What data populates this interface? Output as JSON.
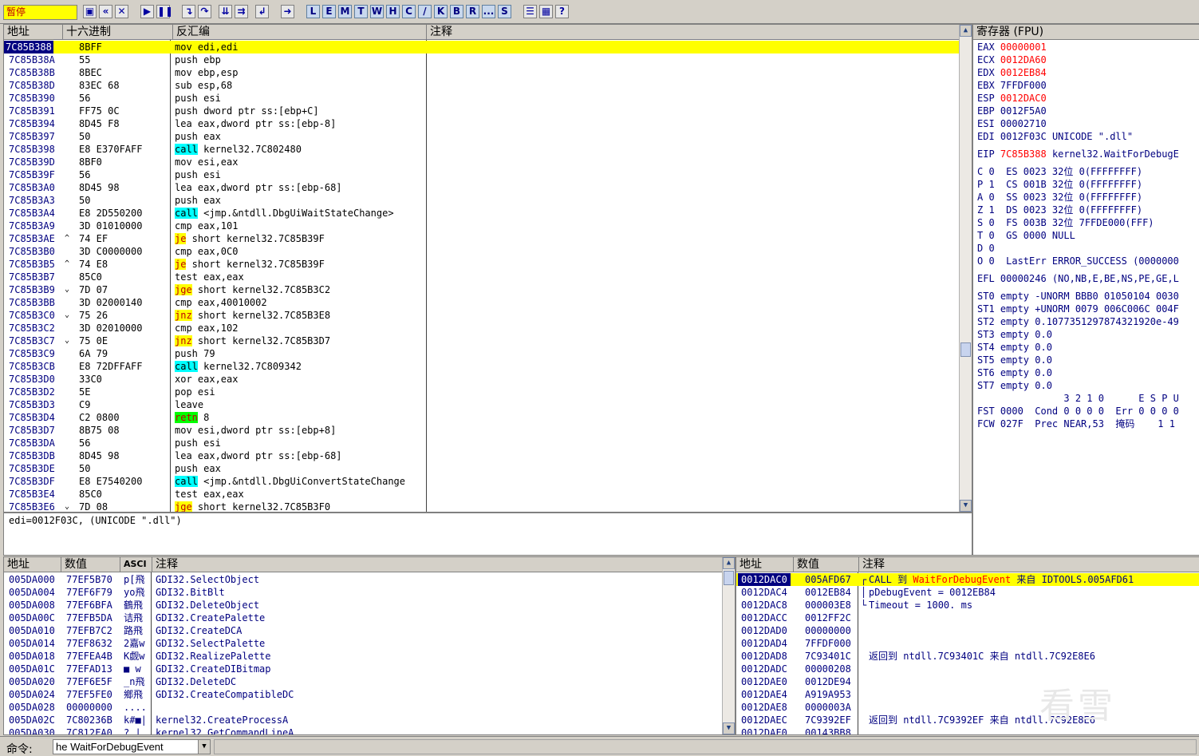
{
  "toolbar": {
    "status": "暂停",
    "letter_buttons": [
      "L",
      "E",
      "M",
      "T",
      "W",
      "H",
      "C",
      "/",
      "K",
      "B",
      "R",
      "...",
      "S"
    ]
  },
  "disasm": {
    "headers": {
      "address": "地址",
      "hex": "十六进制",
      "disasm": "反汇编",
      "comment": "注释"
    },
    "rows": [
      {
        "addr": "7C85B388",
        "mark": "",
        "hex": "8BFF",
        "pre": "",
        "kw": "",
        "asm": "mov edi,edi",
        "style": ""
      },
      {
        "addr": "7C85B38A",
        "mark": "",
        "hex": "55",
        "pre": "",
        "kw": "",
        "asm": "push ebp",
        "style": ""
      },
      {
        "addr": "7C85B38B",
        "mark": "",
        "hex": "8BEC",
        "pre": "",
        "kw": "",
        "asm": "mov ebp,esp",
        "style": ""
      },
      {
        "addr": "7C85B38D",
        "mark": "",
        "hex": "83EC 68",
        "pre": "",
        "kw": "",
        "asm": "sub esp,68",
        "style": ""
      },
      {
        "addr": "7C85B390",
        "mark": "",
        "hex": "56",
        "pre": "",
        "kw": "",
        "asm": "push esi",
        "style": ""
      },
      {
        "addr": "7C85B391",
        "mark": "",
        "hex": "FF75 0C",
        "pre": "",
        "kw": "",
        "asm": "push dword ptr ss:[ebp+C]",
        "style": ""
      },
      {
        "addr": "7C85B394",
        "mark": "",
        "hex": "8D45 F8",
        "pre": "",
        "kw": "",
        "asm": "lea eax,dword ptr ss:[ebp-8]",
        "style": ""
      },
      {
        "addr": "7C85B397",
        "mark": "",
        "hex": "50",
        "pre": "",
        "kw": "",
        "asm": "push eax",
        "style": ""
      },
      {
        "addr": "7C85B398",
        "mark": "",
        "hex": "E8 E370FAFF",
        "pre": "",
        "kw": "call",
        "asm": " kernel32.7C802480",
        "style": "hl"
      },
      {
        "addr": "7C85B39D",
        "mark": "",
        "hex": "8BF0",
        "pre": "",
        "kw": "",
        "asm": "mov esi,eax",
        "style": ""
      },
      {
        "addr": "7C85B39F",
        "mark": "",
        "hex": "56",
        "pre": "",
        "kw": "",
        "asm": "push esi",
        "style": ""
      },
      {
        "addr": "7C85B3A0",
        "mark": "",
        "hex": "8D45 98",
        "pre": "",
        "kw": "",
        "asm": "lea eax,dword ptr ss:[ebp-68]",
        "style": ""
      },
      {
        "addr": "7C85B3A3",
        "mark": "",
        "hex": "50",
        "pre": "",
        "kw": "",
        "asm": "push eax",
        "style": ""
      },
      {
        "addr": "7C85B3A4",
        "mark": "",
        "hex": "E8 2D550200",
        "pre": "",
        "kw": "call",
        "asm": " <jmp.&ntdll.DbgUiWaitStateChange>",
        "style": "hl"
      },
      {
        "addr": "7C85B3A9",
        "mark": "",
        "hex": "3D 01010000",
        "pre": "",
        "kw": "",
        "asm": "cmp eax,101",
        "style": ""
      },
      {
        "addr": "7C85B3AE",
        "mark": "^",
        "hex": "74 EF",
        "pre": "",
        "kw": "je",
        "asm": " short kernel32.7C85B39F",
        "style": "hly"
      },
      {
        "addr": "7C85B3B0",
        "mark": "",
        "hex": "3D C0000000",
        "pre": "",
        "kw": "",
        "asm": "cmp eax,0C0",
        "style": ""
      },
      {
        "addr": "7C85B3B5",
        "mark": "^",
        "hex": "74 E8",
        "pre": "",
        "kw": "je",
        "asm": " short kernel32.7C85B39F",
        "style": "hly"
      },
      {
        "addr": "7C85B3B7",
        "mark": "",
        "hex": "85C0",
        "pre": "",
        "kw": "",
        "asm": "test eax,eax",
        "style": ""
      },
      {
        "addr": "7C85B3B9",
        "mark": "⌄",
        "hex": "7D 07",
        "pre": "",
        "kw": "jge",
        "asm": " short kernel32.7C85B3C2",
        "style": "hly"
      },
      {
        "addr": "7C85B3BB",
        "mark": "",
        "hex": "3D 02000140",
        "pre": "",
        "kw": "",
        "asm": "cmp eax,40010002",
        "style": ""
      },
      {
        "addr": "7C85B3C0",
        "mark": "⌄",
        "hex": "75 26",
        "pre": "",
        "kw": "jnz",
        "asm": " short kernel32.7C85B3E8",
        "style": "hly"
      },
      {
        "addr": "7C85B3C2",
        "mark": "",
        "hex": "3D 02010000",
        "pre": "",
        "kw": "",
        "asm": "cmp eax,102",
        "style": ""
      },
      {
        "addr": "7C85B3C7",
        "mark": "⌄",
        "hex": "75 0E",
        "pre": "",
        "kw": "jnz",
        "asm": " short kernel32.7C85B3D7",
        "style": "hly"
      },
      {
        "addr": "7C85B3C9",
        "mark": "",
        "hex": "6A 79",
        "pre": "",
        "kw": "",
        "asm": "push 79",
        "style": ""
      },
      {
        "addr": "7C85B3CB",
        "mark": "",
        "hex": "E8 72DFFAFF",
        "pre": "",
        "kw": "call",
        "asm": " kernel32.7C809342",
        "style": "hl"
      },
      {
        "addr": "7C85B3D0",
        "mark": "",
        "hex": "33C0",
        "pre": "",
        "kw": "",
        "asm": "xor eax,eax",
        "style": ""
      },
      {
        "addr": "7C85B3D2",
        "mark": "",
        "hex": "5E",
        "pre": "",
        "kw": "",
        "asm": "pop esi",
        "style": ""
      },
      {
        "addr": "7C85B3D3",
        "mark": "",
        "hex": "C9",
        "pre": "",
        "kw": "",
        "asm": "leave",
        "style": ""
      },
      {
        "addr": "7C85B3D4",
        "mark": "",
        "hex": "C2 0800",
        "pre": "",
        "kw": "retn",
        "asm": " 8",
        "style": "hlg"
      },
      {
        "addr": "7C85B3D7",
        "mark": "",
        "hex": "8B75 08",
        "pre": "",
        "kw": "",
        "asm": "mov esi,dword ptr ss:[ebp+8]",
        "style": ""
      },
      {
        "addr": "7C85B3DA",
        "mark": "",
        "hex": "56",
        "pre": "",
        "kw": "",
        "asm": "push esi",
        "style": ""
      },
      {
        "addr": "7C85B3DB",
        "mark": "",
        "hex": "8D45 98",
        "pre": "",
        "kw": "",
        "asm": "lea eax,dword ptr ss:[ebp-68]",
        "style": ""
      },
      {
        "addr": "7C85B3DE",
        "mark": "",
        "hex": "50",
        "pre": "",
        "kw": "",
        "asm": "push eax",
        "style": ""
      },
      {
        "addr": "7C85B3DF",
        "mark": "",
        "hex": "E8 E7540200",
        "pre": "",
        "kw": "call",
        "asm": " <jmp.&ntdll.DbgUiConvertStateChange",
        "style": "hl"
      },
      {
        "addr": "7C85B3E4",
        "mark": "",
        "hex": "85C0",
        "pre": "",
        "kw": "",
        "asm": "test eax,eax",
        "style": ""
      },
      {
        "addr": "7C85B3E6",
        "mark": "⌄",
        "hex": "7D 08",
        "pre": "",
        "kw": "jge",
        "asm": " short kernel32.7C85B3F0",
        "style": "hly"
      }
    ],
    "info_line": "edi=0012F03C, (UNICODE \".dll\")"
  },
  "registers": {
    "title": "寄存器 (FPU)",
    "gpr": [
      {
        "name": "EAX",
        "value": "00000001",
        "changed": true,
        "extra": ""
      },
      {
        "name": "ECX",
        "value": "0012DA60",
        "changed": true,
        "extra": ""
      },
      {
        "name": "EDX",
        "value": "0012EB84",
        "changed": true,
        "extra": ""
      },
      {
        "name": "EBX",
        "value": "7FFDF000",
        "changed": false,
        "extra": ""
      },
      {
        "name": "ESP",
        "value": "0012DAC0",
        "changed": true,
        "extra": ""
      },
      {
        "name": "EBP",
        "value": "0012F5A0",
        "changed": false,
        "extra": ""
      },
      {
        "name": "ESI",
        "value": "00002710",
        "changed": false,
        "extra": ""
      },
      {
        "name": "EDI",
        "value": "0012F03C",
        "changed": false,
        "extra": " UNICODE \".dll\""
      }
    ],
    "eip": {
      "name": "EIP",
      "value": "7C85B388",
      "extra": " kernel32.WaitForDebugE"
    },
    "flags": [
      "C 0  ES 0023 32位 0(FFFFFFFF)",
      "P 1  CS 001B 32位 0(FFFFFFFF)",
      "A 0  SS 0023 32位 0(FFFFFFFF)",
      "Z 1  DS 0023 32位 0(FFFFFFFF)",
      "S 0  FS 003B 32位 7FFDE000(FFF)",
      "T 0  GS 0000 NULL",
      "D 0",
      "O 0  LastErr ERROR_SUCCESS (0000000"
    ],
    "efl": "EFL 00000246 (NO,NB,E,BE,NS,PE,GE,L",
    "fpu": [
      "ST0 empty -UNORM BBB0 01050104 0030",
      "ST1 empty +UNORM 0079 006C006C 004F",
      "ST2 empty 0.1077351297874321920e-49",
      "ST3 empty 0.0",
      "ST4 empty 0.0",
      "ST5 empty 0.0",
      "ST6 empty 0.0",
      "ST7 empty 0.0"
    ],
    "fpu_status": [
      "               3 2 1 0      E S P U",
      "FST 0000  Cond 0 0 0 0  Err 0 0 0 0",
      "FCW 027F  Prec NEAR,53  掩码    1 1"
    ]
  },
  "dump": {
    "headers": {
      "address": "地址",
      "value": "数值",
      "ascii": "ASCI",
      "comment": "注释"
    },
    "rows": [
      {
        "addr": "005DA000",
        "val": "77EF5B70",
        "asc": "p[飛",
        "cmt": "GDI32.SelectObject"
      },
      {
        "addr": "005DA004",
        "val": "77EF6F79",
        "asc": "yo飛",
        "cmt": "GDI32.BitBlt"
      },
      {
        "addr": "005DA008",
        "val": "77EF6BFA",
        "asc": "鶴飛",
        "cmt": "GDI32.DeleteObject"
      },
      {
        "addr": "005DA00C",
        "val": "77EFB5DA",
        "asc": "诘飛",
        "cmt": "GDI32.CreatePalette"
      },
      {
        "addr": "005DA010",
        "val": "77EFB7C2",
        "asc": "路飛",
        "cmt": "GDI32.CreateDCA"
      },
      {
        "addr": "005DA014",
        "val": "77EF8632",
        "asc": "2嘉w",
        "cmt": "GDI32.SelectPalette"
      },
      {
        "addr": "005DA018",
        "val": "77EFEA4B",
        "asc": "K觑w",
        "cmt": "GDI32.RealizePalette"
      },
      {
        "addr": "005DA01C",
        "val": "77EFAD13",
        "asc": "■ w",
        "cmt": "GDI32.CreateDIBitmap"
      },
      {
        "addr": "005DA020",
        "val": "77EF6E5F",
        "asc": "_n飛",
        "cmt": "GDI32.DeleteDC"
      },
      {
        "addr": "005DA024",
        "val": "77EF5FE0",
        "asc": "鄉飛",
        "cmt": "GDI32.CreateCompatibleDC"
      },
      {
        "addr": "005DA028",
        "val": "00000000",
        "asc": "....",
        "cmt": ""
      },
      {
        "addr": "005DA02C",
        "val": "7C80236B",
        "asc": "k#■|",
        "cmt": "kernel32.CreateProcessA"
      },
      {
        "addr": "005DA030",
        "val": "7C812FA0",
        "asc": "?.|",
        "cmt": "kernel32.GetCommandLineA"
      }
    ]
  },
  "stack": {
    "headers": {
      "address": "地址",
      "value": "数值",
      "comment": "注释"
    },
    "rows": [
      {
        "addr": "0012DAC0",
        "val": "005AFD67",
        "br": "┌",
        "cmt": "CALL 到 ",
        "fn": "WaitForDebugEvent",
        "cmt2": " 来自 IDTOOLS.005AFD61",
        "sel": true
      },
      {
        "addr": "0012DAC4",
        "val": "0012EB84",
        "br": "│",
        "cmt": "pDebugEvent = 0012EB84",
        "fn": "",
        "cmt2": "",
        "sel": false
      },
      {
        "addr": "0012DAC8",
        "val": "000003E8",
        "br": "└",
        "cmt": "Timeout = 1000. ms",
        "fn": "",
        "cmt2": "",
        "sel": false
      },
      {
        "addr": "0012DACC",
        "val": "0012FF2C",
        "br": "",
        "cmt": "",
        "fn": "",
        "cmt2": "",
        "sel": false
      },
      {
        "addr": "0012DAD0",
        "val": "00000000",
        "br": "",
        "cmt": "",
        "fn": "",
        "cmt2": "",
        "sel": false
      },
      {
        "addr": "0012DAD4",
        "val": "7FFDF000",
        "br": "",
        "cmt": "",
        "fn": "",
        "cmt2": "",
        "sel": false
      },
      {
        "addr": "0012DAD8",
        "val": "7C93401C",
        "br": "",
        "cmt": "返回到 ntdll.7C93401C 来自 ntdll.7C92E8E6",
        "fn": "",
        "cmt2": "",
        "sel": false
      },
      {
        "addr": "0012DADC",
        "val": "00000208",
        "br": "",
        "cmt": "",
        "fn": "",
        "cmt2": "",
        "sel": false
      },
      {
        "addr": "0012DAE0",
        "val": "0012DE94",
        "br": "",
        "cmt": "",
        "fn": "",
        "cmt2": "",
        "sel": false
      },
      {
        "addr": "0012DAE4",
        "val": "A919A953",
        "br": "",
        "cmt": "",
        "fn": "",
        "cmt2": "",
        "sel": false
      },
      {
        "addr": "0012DAE8",
        "val": "0000003A",
        "br": "",
        "cmt": "",
        "fn": "",
        "cmt2": "",
        "sel": false
      },
      {
        "addr": "0012DAEC",
        "val": "7C9392EF",
        "br": "",
        "cmt": "返回到 ntdll.7C9392EF 来自 ntdll.7C92E8E6",
        "fn": "",
        "cmt2": "",
        "sel": false
      },
      {
        "addr": "0012DAF0",
        "val": "00143BB8",
        "br": "",
        "cmt": "",
        "fn": "",
        "cmt2": "",
        "sel": false
      }
    ]
  },
  "command": {
    "label": "命令:",
    "value": "he WaitForDebugEvent"
  },
  "watermark": "看雪"
}
